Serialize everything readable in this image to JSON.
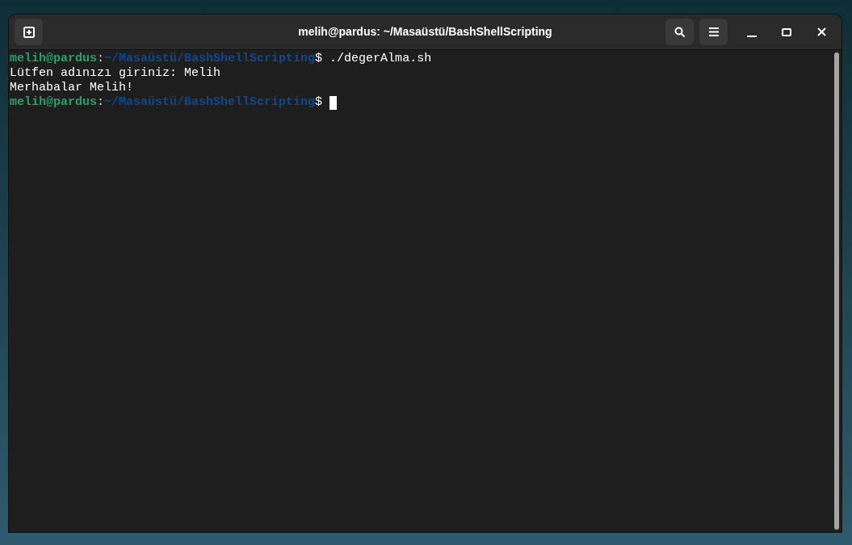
{
  "window": {
    "title": "melih@pardus: ~/Masaüstü/BashShellScripting"
  },
  "terminal": {
    "lines": [
      {
        "kind": "prompt",
        "user_host": "melih@pardus",
        "separator": ":",
        "path": "~/Masaüstü/BashShellScripting",
        "symbol": "$",
        "command": " ./degerAlma.sh",
        "cursor": false
      },
      {
        "kind": "output",
        "text": "Lütfen adınızı giriniz: Melih"
      },
      {
        "kind": "output",
        "text": "Merhabalar Melih!"
      },
      {
        "kind": "prompt",
        "user_host": "melih@pardus",
        "separator": ":",
        "path": "~/Masaüstü/BashShellScripting",
        "symbol": "$",
        "cursor": true
      }
    ]
  }
}
